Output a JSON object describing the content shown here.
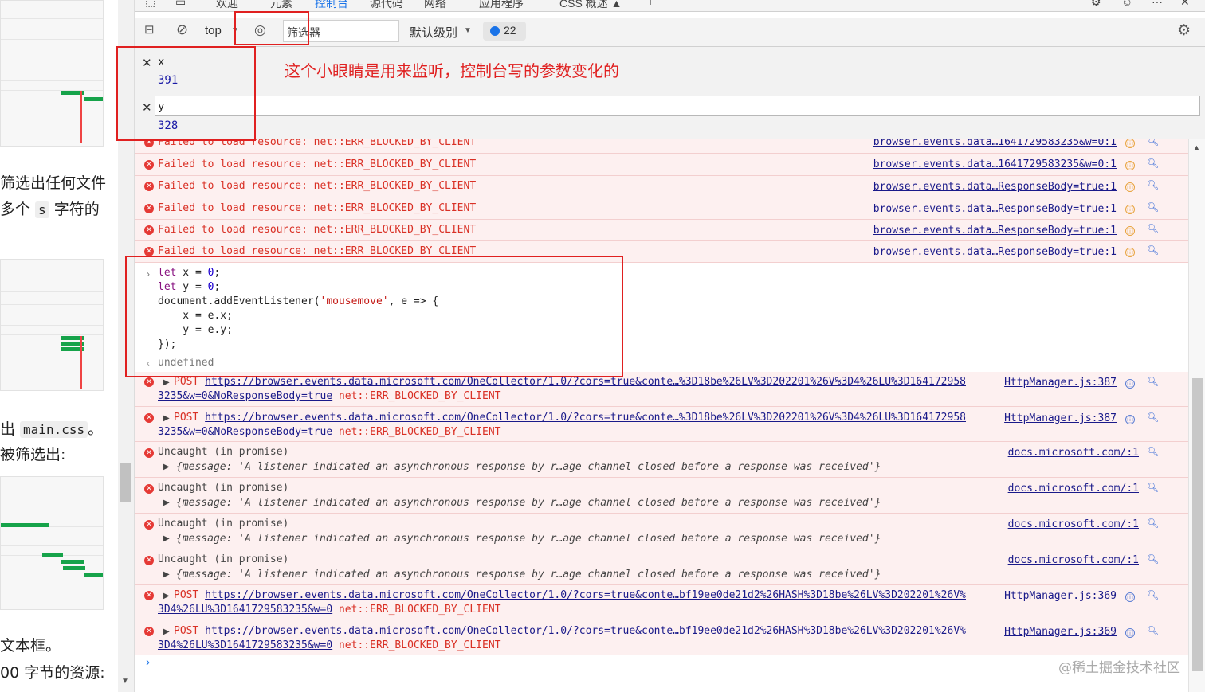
{
  "left_article": {
    "lines": [
      {
        "text": "筛选出任何文件"
      },
      {
        "pre": "多个 ",
        "code": "s",
        "post": " 字符的"
      },
      {
        "pre": "出 ",
        "code": "main.css",
        "post": "。"
      },
      {
        "text": "被筛选出:"
      },
      {
        "text": "文本框。"
      },
      {
        "text": "00 字节的资源:"
      }
    ]
  },
  "tabs": [
    "欢迎",
    "元素",
    "控制台",
    "源代码",
    "网络",
    "应用程序",
    "CSS 概述 ▲",
    "+"
  ],
  "toolbar": {
    "context": "top",
    "filter_placeholder": "筛选器",
    "level": "默认级别",
    "issues_count": "22"
  },
  "live_expressions": [
    {
      "name": "x",
      "value": "391"
    },
    {
      "name": "y",
      "value": "328"
    }
  ],
  "annotation": "这个小眼睛是用来监听，控制台写的参数变化的",
  "blocked_msg": "Failed to load resource: net::ERR_BLOCKED_BY_CLIENT",
  "blocked_sources": [
    "browser.events.data…1641729583235&w=0:1",
    "browser.events.data…1641729583235&w=0:1",
    "browser.events.data…ResponseBody=true:1",
    "browser.events.data…ResponseBody=true:1",
    "browser.events.data…ResponseBody=true:1",
    "browser.events.data…ResponseBody=true:1"
  ],
  "code_lines": [
    "let x = 0;",
    "let y = 0;",
    "document.addEventListener('mousemove', e => {",
    "    x = e.x;",
    "    y = e.y;",
    "});"
  ],
  "result": "undefined",
  "post_rows": [
    {
      "method": "POST",
      "url1": "https://browser.events.data.microsoft.com/OneCollector/1.0/?cors=true&conte…%3D18be%26LV%3D202201%26V%3D4%26LU%3D164172958",
      "url2": "3235&w=0&NoResponseBody=true",
      "error": "net::ERR_BLOCKED_BY_CLIENT",
      "source": "HttpManager.js:387"
    },
    {
      "method": "POST",
      "url1": "https://browser.events.data.microsoft.com/OneCollector/1.0/?cors=true&conte…%3D18be%26LV%3D202201%26V%3D4%26LU%3D164172958",
      "url2": "3235&w=0&NoResponseBody=true",
      "error": "net::ERR_BLOCKED_BY_CLIENT",
      "source": "HttpManager.js:387"
    }
  ],
  "uncaught_rows": [
    {
      "title": "Uncaught (in promise)",
      "detail": "{message: 'A listener indicated an asynchronous response by r…age channel closed before a response was received'}",
      "source": "docs.microsoft.com/:1"
    },
    {
      "title": "Uncaught (in promise)",
      "detail": "{message: 'A listener indicated an asynchronous response by r…age channel closed before a response was received'}",
      "source": "docs.microsoft.com/:1"
    },
    {
      "title": "Uncaught (in promise)",
      "detail": "{message: 'A listener indicated an asynchronous response by r…age channel closed before a response was received'}",
      "source": "docs.microsoft.com/:1"
    },
    {
      "title": "Uncaught (in promise)",
      "detail": "{message: 'A listener indicated an asynchronous response by r…age channel closed before a response was received'}",
      "source": "docs.microsoft.com/:1"
    }
  ],
  "post_rows_2": [
    {
      "method": "POST",
      "url1": "https://browser.events.data.microsoft.com/OneCollector/1.0/?cors=true&conte…bf19ee0de21d2%26HASH%3D18be%26LV%3D202201%26V%",
      "url2": "3D4%26LU%3D1641729583235&w=0",
      "error": "net::ERR_BLOCKED_BY_CLIENT",
      "source": "HttpManager.js:369"
    },
    {
      "method": "POST",
      "url1": "https://browser.events.data.microsoft.com/OneCollector/1.0/?cors=true&conte…bf19ee0de21d2%26HASH%3D18be%26LV%3D202201%26V%",
      "url2": "3D4%26LU%3D1641729583235&w=0",
      "error": "net::ERR_BLOCKED_BY_CLIENT",
      "source": "HttpManager.js:369"
    }
  ],
  "watermark": "@稀土掘金技术社区",
  "icons": {
    "close": "close-icon",
    "eye": "eye-icon",
    "clear": "clear-console-icon",
    "gear": "gear-icon",
    "error": "error-icon",
    "expand": "expand-triangle-icon",
    "search": "search-icon"
  },
  "colors": {
    "error_text": "#d93025",
    "error_bg": "#fdf0f0",
    "link": "#1a1a8a",
    "annotation_red": "#e02020"
  }
}
